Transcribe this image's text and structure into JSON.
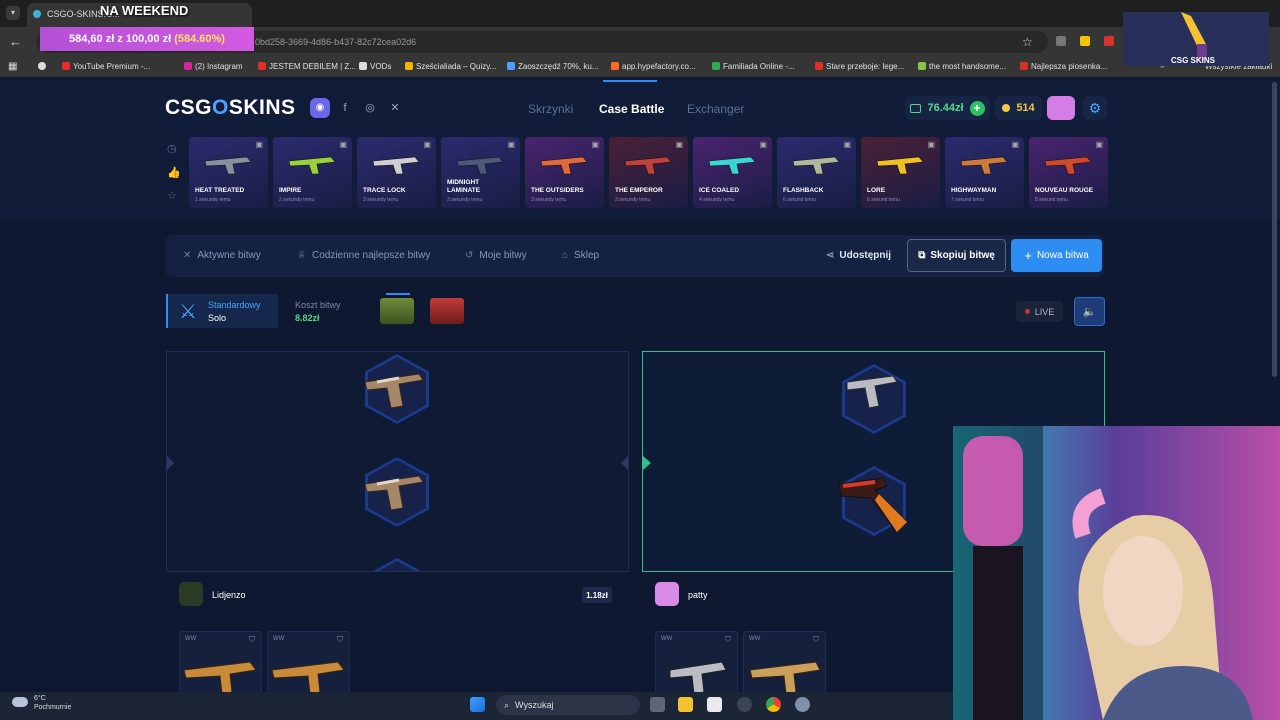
{
  "browser": {
    "tab_title": "CSGO-SKINS.C...",
    "overlay_title": "NA WEEKEND",
    "url_fragment": "0bd258-3669-4d86-b437-82c72cea02d6",
    "progress": {
      "amount": "584,60 zł",
      "goal": "z 100,00 zł",
      "percent": "(584.60%)"
    },
    "bookmarks": [
      {
        "label": "YouTube Premium -...",
        "color": "#e52d27"
      },
      {
        "label": "(2) Instagram",
        "color": "#d6249f"
      },
      {
        "label": "JESTEM DEBILEM | Z...",
        "color": "#e52d27"
      },
      {
        "label": "VODs",
        "color": "#dddddd"
      },
      {
        "label": "Sześcialiada – Quizy...",
        "color": "#f5b400"
      },
      {
        "label": "Zaoszczędź 70%, ku...",
        "color": "#4aa3ff"
      },
      {
        "label": "app.hypefactory.co...",
        "color": "#ff6a2a"
      },
      {
        "label": "Familiada Online -...",
        "color": "#34a853"
      },
      {
        "label": "Stare przeboje: lege...",
        "color": "#e52d27"
      },
      {
        "label": "the most handsome...",
        "color": "#8bc34a"
      },
      {
        "label": "Najlepsza piosenka...",
        "color": "#d93025"
      }
    ],
    "bookmarks_overflow": "Wszystkie zakładki"
  },
  "site": {
    "logo": {
      "left": "CSG",
      "o": "O",
      "right": "SKINS"
    },
    "nav": {
      "cases": "Skrzynki",
      "battle": "Case Battle",
      "exchanger": "Exchanger"
    },
    "balance": "76.44zł",
    "coins": "514",
    "drops": [
      {
        "name": "HEAT TREATED",
        "time": "1 sekundę temu",
        "bg": "#2b2b6e",
        "gun": "#8a8f9e"
      },
      {
        "name": "IMPIRE",
        "time": "2 sekundy temu",
        "bg": "#2b2b6e",
        "gun": "#9ad13a"
      },
      {
        "name": "TRACE LOCK",
        "time": "3 sekundy temu",
        "bg": "#2b2b6e",
        "gun": "#cfcfcf"
      },
      {
        "name": "MIDNIGHT\nLAMINATE",
        "time": "3 sekundy temu",
        "bg": "#2b2b6e",
        "gun": "#4a5a7a"
      },
      {
        "name": "THE OUTSIDERS",
        "time": "3 sekundy temu",
        "bg": "#4a2470",
        "gun": "#e06a3a"
      },
      {
        "name": "THE EMPEROR",
        "time": "3 sekundy temu",
        "bg": "#4a2035",
        "gun": "#c0403a"
      },
      {
        "name": "ICE COALED",
        "time": "4 sekundy temu",
        "bg": "#4a2470",
        "gun": "#3ad6d6"
      },
      {
        "name": "FLASHBACK",
        "time": "6 sekund temu",
        "bg": "#2b2b6e",
        "gun": "#b0b89a"
      },
      {
        "name": "LORE",
        "time": "6 sekund temu",
        "bg": "#4a2035",
        "gun": "#f0c020"
      },
      {
        "name": "HIGHWAYMAN",
        "time": "7 sekund temu",
        "bg": "#2b2b6e",
        "gun": "#d07a3a"
      },
      {
        "name": "NOUVEAU ROUGE",
        "time": "8 sekund temu",
        "bg": "#4a2470",
        "gun": "#d04a2a"
      }
    ],
    "battle_tabs": {
      "active": "Aktywne bitwy",
      "daily": "Codzienne najlepsze bitwy",
      "mine": "Moje bitwy",
      "shop": "Sklep"
    },
    "share": "Udostępnij",
    "copy": "Skopiuj bitwę",
    "new": "Nowa bitwa",
    "mode": {
      "type": "Standardowy",
      "players": "Solo"
    },
    "cost": {
      "label": "Koszt bitwy",
      "value": "8.82zł"
    },
    "live": "LIVE",
    "players": [
      {
        "name": "Lidjenzo",
        "value": "1.18zł"
      },
      {
        "name": "patty"
      }
    ],
    "item_tag": "WW"
  },
  "taskbar": {
    "temp": "6°C",
    "weather": "Pochmurnie",
    "search": "Wyszukaj"
  },
  "webcam_label": "CSG SKINS"
}
